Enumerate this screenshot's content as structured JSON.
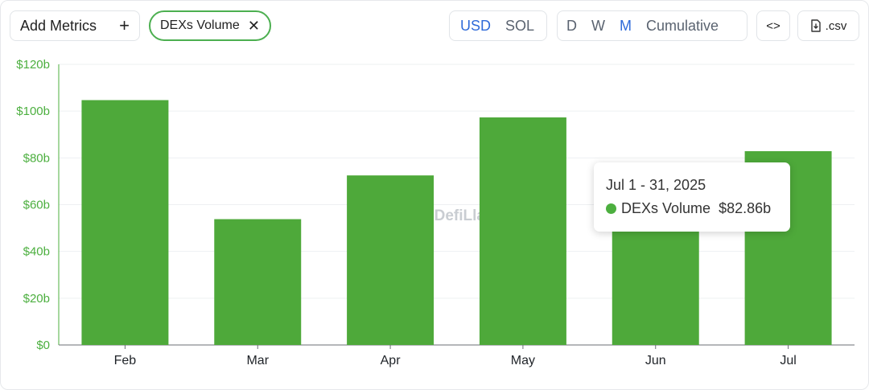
{
  "toolbar": {
    "add_metrics_label": "Add Metrics",
    "metric_chip_label": "DEXs Volume",
    "currency_options": [
      {
        "label": "USD",
        "active": true
      },
      {
        "label": "SOL",
        "active": false
      }
    ],
    "period_options": [
      {
        "label": "D",
        "active": false
      },
      {
        "label": "W",
        "active": false
      },
      {
        "label": "M",
        "active": true
      },
      {
        "label": "Cumulative",
        "active": false
      }
    ],
    "embed_label": "<>",
    "csv_label": ".csv"
  },
  "colors": {
    "bar": "#4ea93a",
    "axis_text": "#4caf3f",
    "grid": "#eef0f2",
    "accent": "#2f6bd9"
  },
  "watermark": "DefiLlama",
  "tooltip": {
    "date": "Jul 1 - 31, 2025",
    "series": "DEXs Volume",
    "value": "$82.86b"
  },
  "chart_data": {
    "type": "bar",
    "categories": [
      "Feb",
      "Mar",
      "Apr",
      "May",
      "Jun",
      "Jul"
    ],
    "values": [
      104.7,
      53.8,
      72.5,
      97.3,
      66.0,
      82.86
    ],
    "ylim": [
      0,
      120
    ],
    "y_ticks": [
      0,
      20,
      40,
      60,
      80,
      100,
      120
    ],
    "y_tick_labels": [
      "$0",
      "$20b",
      "$40b",
      "$60b",
      "$80b",
      "$100b",
      "$120b"
    ],
    "grid": true,
    "unit": "billion USD"
  }
}
